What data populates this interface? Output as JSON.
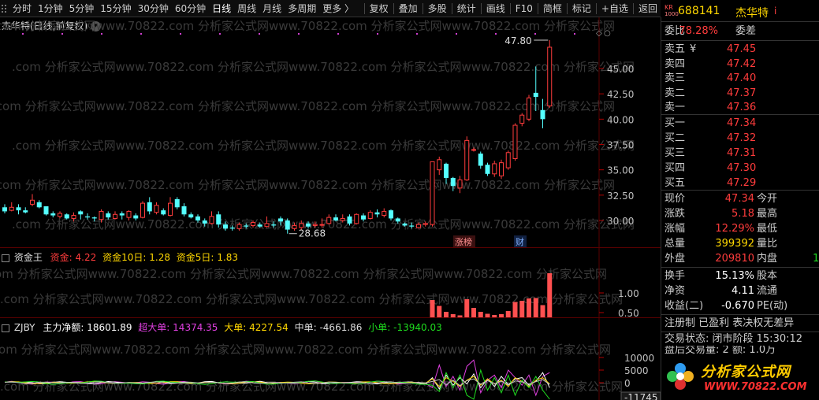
{
  "toolbar": {
    "tabs": [
      "分时",
      "1分钟",
      "5分钟",
      "15分钟",
      "30分钟",
      "60分钟",
      "日线",
      "周线",
      "月线",
      "多周期",
      "更多 〉"
    ],
    "active_tab": "日线",
    "tools": [
      "复权",
      "叠加",
      "多股",
      "统计",
      "画线",
      "F10",
      "简框",
      "标记",
      "+自选",
      "返回"
    ]
  },
  "kline": {
    "title": "杰华特(日线,前复权)",
    "high_label": "47.80",
    "low_label": "28.68",
    "tag_zhangbang": "涨榜",
    "tag_cai": "财",
    "y_ticks": [
      "45.00",
      "42.50",
      "40.00",
      "37.50",
      "35.00",
      "32.50",
      "30.00"
    ],
    "watermark": ".com 分析家公式网www.70822.com 分析家公式网www.70822.com 分析家公式网www.70822.com 分析家公式网"
  },
  "zjw": {
    "name": "资金王",
    "l1": "资金:",
    "v1": "4.22",
    "l2": "资金10日:",
    "v2": "1.28",
    "l3": "资金5日:",
    "v3": "1.83",
    "y_ticks": [
      "1.00",
      "0.50"
    ]
  },
  "zjby": {
    "name": "ZJBY",
    "l_main": "主力净额:",
    "v_main": "18601.89",
    "l_super": "超大单:",
    "v_super": "14374.35",
    "l_big": "大单:",
    "v_big": "4227.54",
    "l_mid": "中单:",
    "v_mid": "-4661.86",
    "l_small": "小单:",
    "v_small": "-13940.03",
    "y_ticks": [
      "10000",
      "5000",
      "0"
    ],
    "bottom_tick": "-11745"
  },
  "quote": {
    "code": "688141",
    "name": "杰华特",
    "info_icon": "i",
    "badge_top": "KR",
    "badge_bottom": "1000",
    "weibi_label": "委比",
    "weibi_value": "78.28%",
    "weicha_label": "委差",
    "asks": [
      {
        "label": "卖五",
        "price": "47.45"
      },
      {
        "label": "卖四",
        "price": "47.42"
      },
      {
        "label": "卖三",
        "price": "47.40"
      },
      {
        "label": "卖二",
        "price": "47.37"
      },
      {
        "label": "卖一",
        "price": "47.36"
      }
    ],
    "yen": "¥",
    "bids": [
      {
        "label": "买一",
        "price": "47.34"
      },
      {
        "label": "买二",
        "price": "47.32"
      },
      {
        "label": "买三",
        "price": "47.31"
      },
      {
        "label": "买四",
        "price": "47.30"
      },
      {
        "label": "买五",
        "price": "47.29"
      }
    ],
    "stats": [
      {
        "l": "现价",
        "v": "47.34",
        "c": "red",
        "l2": "今开"
      },
      {
        "l": "涨跌",
        "v": "5.18",
        "c": "red",
        "l2": "最高"
      },
      {
        "l": "涨幅",
        "v": "12.29%",
        "c": "red",
        "l2": "最低"
      },
      {
        "l": "总量",
        "v": "399392",
        "c": "yellow",
        "l2": "量比"
      },
      {
        "l": "外盘",
        "v": "209810",
        "c": "red",
        "l2": "内盘",
        "v2": "1"
      }
    ],
    "stats2": [
      {
        "l": "换手",
        "v": "15.13%",
        "l2": "股本"
      },
      {
        "l": "净资",
        "v": "4.11",
        "l2": "流通"
      },
      {
        "l": "收益(二)",
        "v": "-0.670",
        "l2": "PE(动)"
      }
    ],
    "tags_line": "注册制 已盈利 表决权无差异",
    "trade_status": "交易状态: 闭市阶段 15:30:12",
    "after_hours": "盘后交易量: 2  额: 1.0万",
    "logo_text": "分析家公式网",
    "logo_url": "WWW.70822.COM"
  }
}
